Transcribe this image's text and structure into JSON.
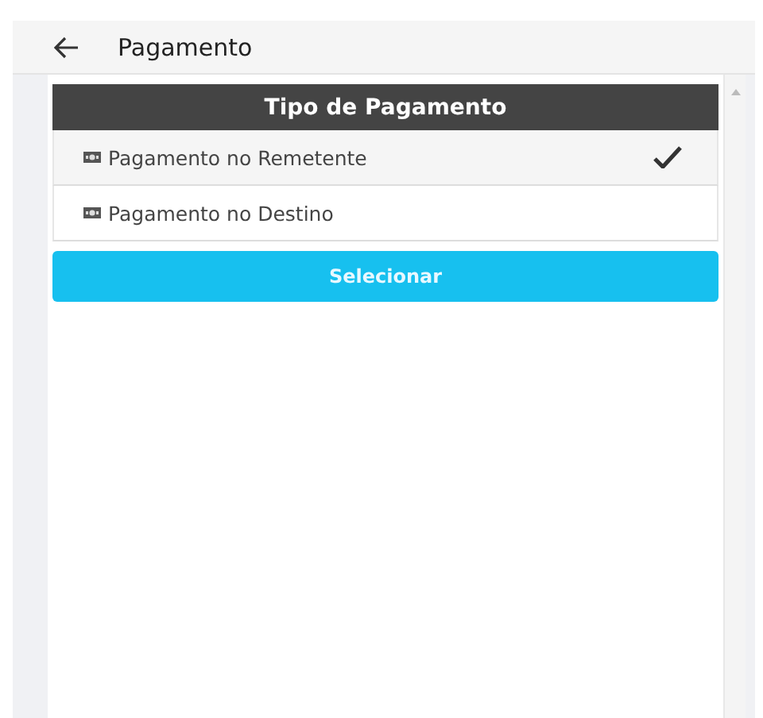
{
  "header": {
    "title": "Pagamento"
  },
  "payment_list": {
    "title": "Tipo de Pagamento",
    "options": [
      {
        "label": "Pagamento no Remetente",
        "selected": true
      },
      {
        "label": "Pagamento no Destino",
        "selected": false
      }
    ]
  },
  "buttons": [
    "Selecionar"
  ]
}
